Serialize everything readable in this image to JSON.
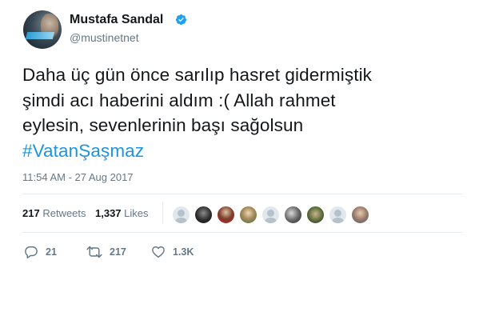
{
  "user": {
    "name": "Mustafa Sandal",
    "handle": "@mustinetnet",
    "verified": true
  },
  "tweet": {
    "lines": [
      "Daha üç gün önce sarılıp hasret gidermiştik",
      "şimdi acı haberini aldım :( Allah rahmet",
      "eylesin, sevenlerinin başı sağolsun"
    ],
    "hashtag": "#VatanŞaşmaz",
    "timestamp": "11:54 AM - 27 Aug 2017"
  },
  "stats": {
    "retweets_count": "217",
    "retweets_label": "Retweets",
    "likes_count": "1,337",
    "likes_label": "Likes"
  },
  "liked_by": [
    {
      "icon": "default-avatar-icon"
    },
    {
      "icon": "user-avatar-icon"
    },
    {
      "icon": "user-avatar-icon"
    },
    {
      "icon": "user-avatar-icon"
    },
    {
      "icon": "default-avatar-icon"
    },
    {
      "icon": "user-avatar-icon"
    },
    {
      "icon": "user-avatar-icon"
    },
    {
      "icon": "default-avatar-icon"
    },
    {
      "icon": "user-avatar-icon"
    }
  ],
  "actions": {
    "reply_count": "21",
    "retweet_count": "217",
    "like_count": "1.3K"
  },
  "colors": {
    "hashtag": "#1b95e0",
    "verified": "#1da1f2",
    "secondary_text": "#657786",
    "divider": "#e6ecf0"
  }
}
